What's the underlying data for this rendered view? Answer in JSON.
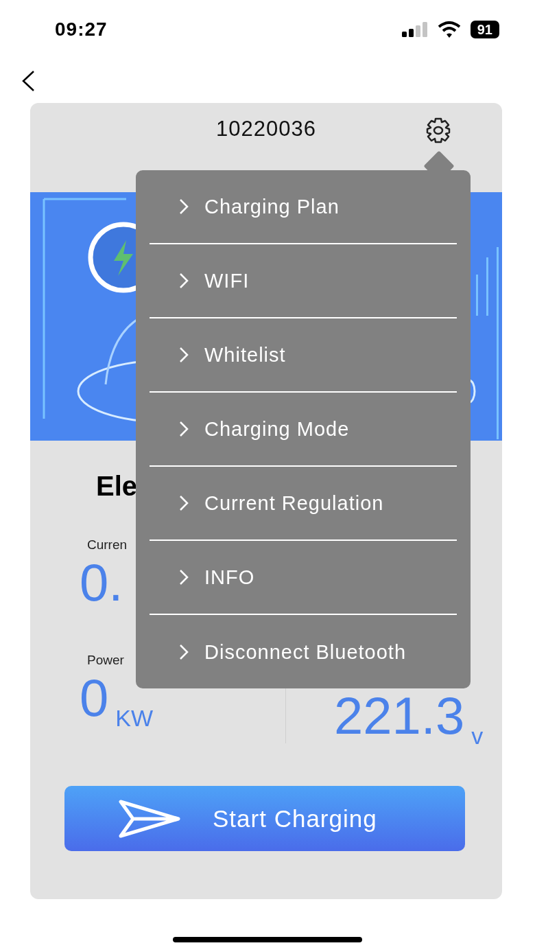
{
  "status_bar": {
    "time": "09:27",
    "battery": "91"
  },
  "device": {
    "title": "10220036"
  },
  "heading": "Ele",
  "stats": [
    {
      "label": "Curren",
      "value": "0."
    },
    {
      "label": "Power",
      "value": "0",
      "unit": "KW"
    },
    {
      "value": "221.3",
      "unit": "v"
    }
  ],
  "start_button": {
    "label": "Start Charging"
  },
  "menu": {
    "items": [
      {
        "label": "Charging Plan"
      },
      {
        "label": "WIFI"
      },
      {
        "label": "Whitelist"
      },
      {
        "label": "Charging Mode"
      },
      {
        "label": "Current Regulation"
      },
      {
        "label": "INFO"
      },
      {
        "label": "Disconnect Bluetooth"
      }
    ]
  }
}
